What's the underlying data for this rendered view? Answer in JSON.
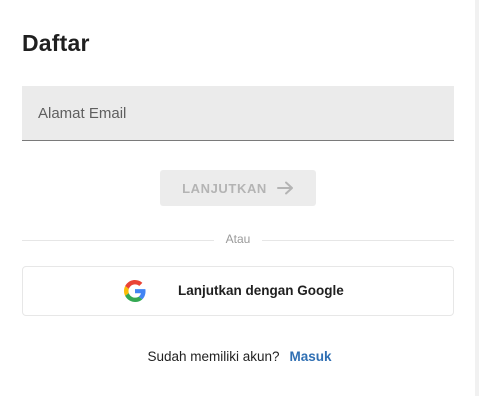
{
  "page": {
    "title": "Daftar"
  },
  "email": {
    "placeholder": "Alamat Email",
    "value": ""
  },
  "continue_button": {
    "label": "LANJUTKAN",
    "icon": "arrow-right-icon",
    "state": "disabled"
  },
  "divider": {
    "label": "Atau"
  },
  "google_button": {
    "label": "Lanjutkan dengan Google",
    "icon": "google-icon"
  },
  "signin": {
    "prompt": "Sudah memiliki akun?",
    "link_label": "Masuk"
  },
  "colors": {
    "link": "#2f6fb3",
    "input_bg": "#ebebeb",
    "button_disabled_bg": "#ececec",
    "button_disabled_text": "#b4b4b4"
  }
}
